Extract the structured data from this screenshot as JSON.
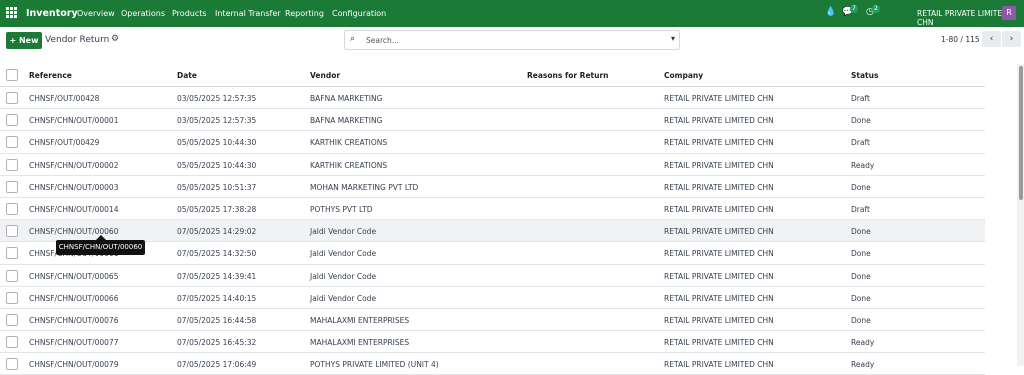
{
  "topbar": {
    "app_name": "Inventory",
    "menu": [
      "Overview",
      "Operations",
      "Products",
      "Internal Transfer",
      "Reporting",
      "Configuration"
    ],
    "messages_count": "7",
    "activities_count": "2",
    "company": "RETAIL PRIVATE LIMITED CHN",
    "avatar_initial": "R",
    "icons": [
      "apps-grid-icon",
      "drop-icon",
      "chat-icon",
      "clock-icon"
    ]
  },
  "control": {
    "new_label": "+ New",
    "title": "Vendor Return",
    "search_placeholder": "Search...",
    "pager_text": "1-80 / 115"
  },
  "table": {
    "columns": [
      "Reference",
      "Date",
      "Vendor",
      "Reasons for Return",
      "Company",
      "Status"
    ],
    "rows": [
      {
        "reference": "CHNSF/OUT/00428",
        "date": "03/05/2025 12:57:35",
        "vendor": "BAFNA MARKETING",
        "reason": "",
        "company": "RETAIL PRIVATE LIMITED CHN",
        "status": "Draft"
      },
      {
        "reference": "CHNSF/CHN/OUT/00001",
        "date": "03/05/2025 12:57:35",
        "vendor": "BAFNA MARKETING",
        "reason": "",
        "company": "RETAIL PRIVATE LIMITED CHN",
        "status": "Done"
      },
      {
        "reference": "CHNSF/OUT/00429",
        "date": "05/05/2025 10:44:30",
        "vendor": "KARTHIK CREATIONS",
        "reason": "",
        "company": "RETAIL PRIVATE LIMITED CHN",
        "status": "Draft"
      },
      {
        "reference": "CHNSF/CHN/OUT/00002",
        "date": "05/05/2025 10:44:30",
        "vendor": "KARTHIK CREATIONS",
        "reason": "",
        "company": "RETAIL PRIVATE LIMITED CHN",
        "status": "Ready"
      },
      {
        "reference": "CHNSF/CHN/OUT/00003",
        "date": "05/05/2025 10:51:37",
        "vendor": "MOHAN MARKETING PVT LTD",
        "reason": "",
        "company": "RETAIL PRIVATE LIMITED CHN",
        "status": "Done"
      },
      {
        "reference": "CHNSF/CHN/OUT/00014",
        "date": "05/05/2025 17:38:28",
        "vendor": "POTHYS PVT LTD",
        "reason": "",
        "company": "RETAIL PRIVATE LIMITED CHN",
        "status": "Draft"
      },
      {
        "reference": "CHNSF/CHN/OUT/00060",
        "date": "07/05/2025 14:29:02",
        "vendor": "Jaldi Vendor Code",
        "reason": "",
        "company": "RETAIL PRIVATE LIMITED CHN",
        "status": "Done"
      },
      {
        "reference": "CHNSF/CHN/OUT/00061",
        "date": "07/05/2025 14:32:50",
        "vendor": "Jaldi Vendor Code",
        "reason": "",
        "company": "RETAIL PRIVATE LIMITED CHN",
        "status": "Done"
      },
      {
        "reference": "CHNSF/CHN/OUT/00065",
        "date": "07/05/2025 14:39:41",
        "vendor": "Jaldi Vendor Code",
        "reason": "",
        "company": "RETAIL PRIVATE LIMITED CHN",
        "status": "Done"
      },
      {
        "reference": "CHNSF/CHN/OUT/00066",
        "date": "07/05/2025 14:40:15",
        "vendor": "Jaldi Vendor Code",
        "reason": "",
        "company": "RETAIL PRIVATE LIMITED CHN",
        "status": "Done"
      },
      {
        "reference": "CHNSF/CHN/OUT/00076",
        "date": "07/05/2025 16:44:58",
        "vendor": "MAHALAXMI ENTERPRISES",
        "reason": "",
        "company": "RETAIL PRIVATE LIMITED CHN",
        "status": "Done"
      },
      {
        "reference": "CHNSF/CHN/OUT/00077",
        "date": "07/05/2025 16:45:32",
        "vendor": "MAHALAXMI ENTERPRISES",
        "reason": "",
        "company": "RETAIL PRIVATE LIMITED CHN",
        "status": "Ready"
      },
      {
        "reference": "CHNSF/CHN/OUT/00079",
        "date": "07/05/2025 17:06:49",
        "vendor": "POTHYS PRIVATE LIMITED (UNIT 4)",
        "reason": "",
        "company": "RETAIL PRIVATE LIMITED CHN",
        "status": "Ready"
      }
    ]
  },
  "tooltip": "CHNSF/CHN/OUT/00060",
  "colors": {
    "brand": "#1b7a36",
    "avatar": "#8e5aa7"
  }
}
